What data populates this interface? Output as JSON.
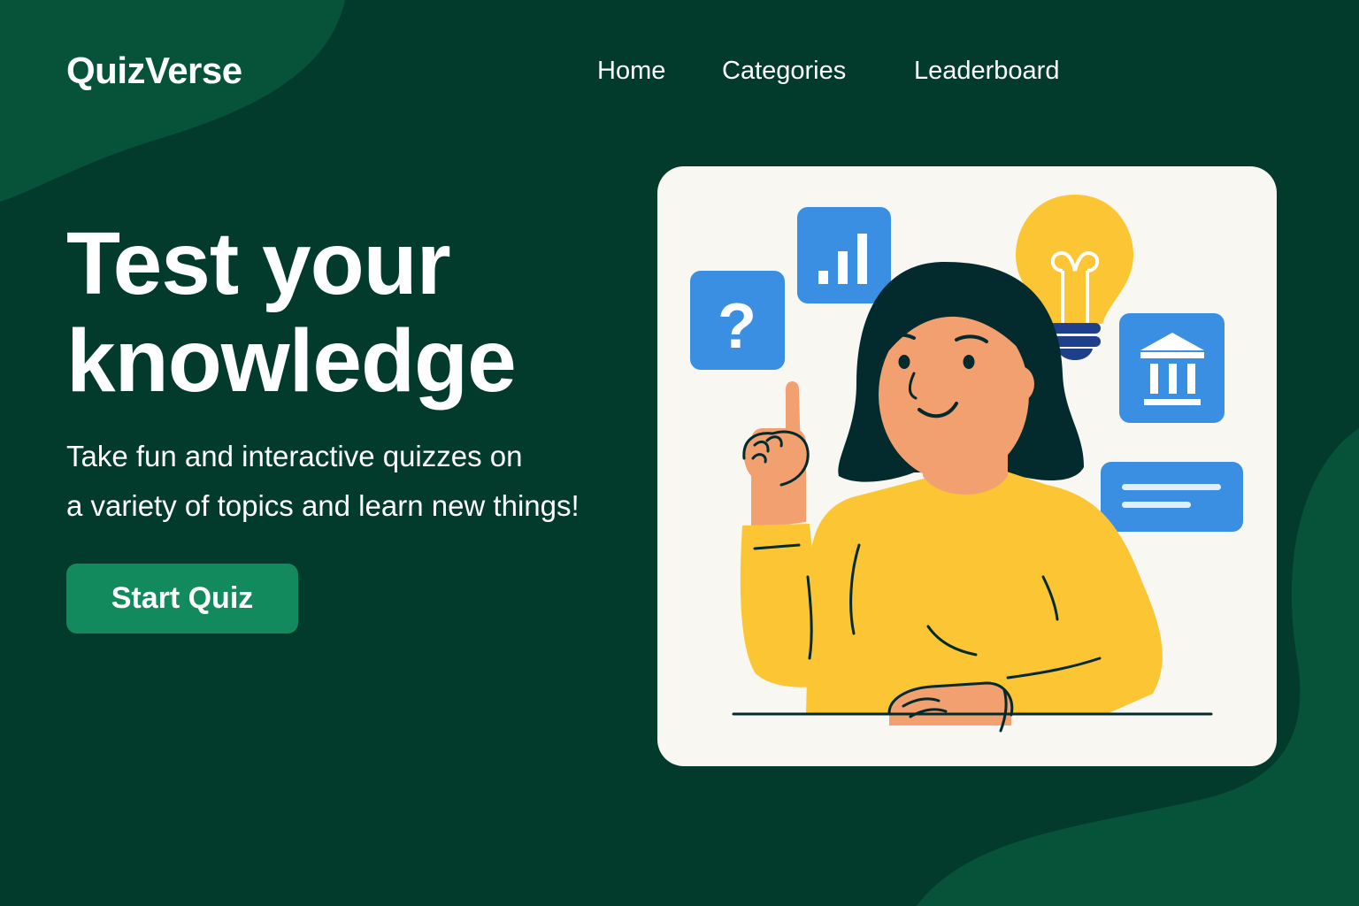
{
  "brand": {
    "name": "QuizVerse"
  },
  "nav": {
    "items": [
      {
        "label": "Home"
      },
      {
        "label": "Categories"
      },
      {
        "label": "Leaderboard"
      }
    ]
  },
  "hero": {
    "title_line1": "Test your",
    "title_line2": "knowledge",
    "subtitle_line1": "Take fun and interactive quizzes on",
    "subtitle_line2": "a variety of topics and learn new things!",
    "cta_label": "Start Quiz"
  },
  "illustration": {
    "question_glyph": "?",
    "icons": [
      "question-icon",
      "bar-chart-icon",
      "lightbulb-icon",
      "bank-icon",
      "text-card-icon"
    ]
  },
  "colors": {
    "background": "#023b2c",
    "blob": "#07533a",
    "button": "#138a5e",
    "card": "#f8f7f2",
    "icon_blue": "#3b8fe3",
    "sweater": "#fcc534",
    "hair": "#032a2c",
    "skin": "#f2a070"
  }
}
